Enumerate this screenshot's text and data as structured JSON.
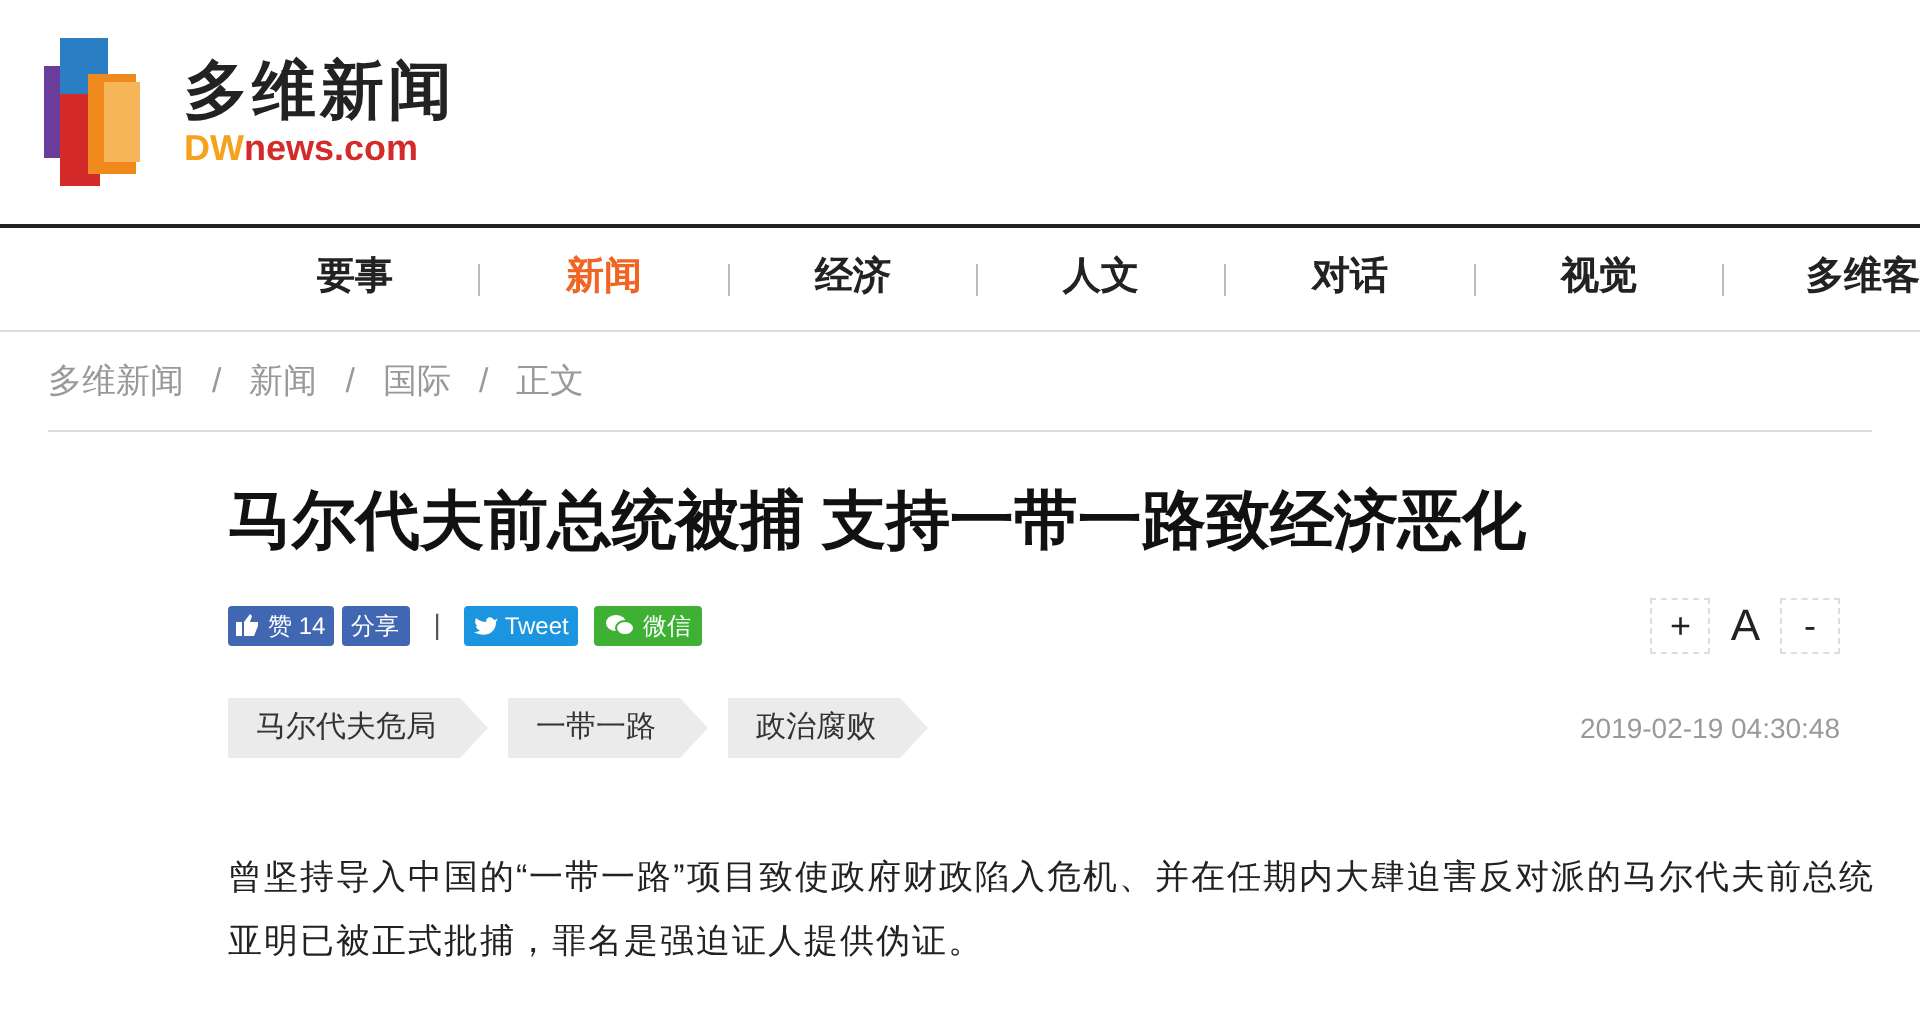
{
  "logo": {
    "name": "多维新闻",
    "domain_prefix": "DW",
    "domain_rest": "news.com"
  },
  "nav": [
    {
      "label": "要事",
      "selected": false
    },
    {
      "label": "新闻",
      "selected": true
    },
    {
      "label": "经济",
      "selected": false
    },
    {
      "label": "人文",
      "selected": false
    },
    {
      "label": "对话",
      "selected": false
    },
    {
      "label": "视觉",
      "selected": false
    },
    {
      "label": "多维客",
      "selected": false
    }
  ],
  "breadcrumb": [
    "多维新闻",
    "新闻",
    "国际",
    "正文"
  ],
  "breadcrumb_separator": "/",
  "article": {
    "title": "马尔代夫前总统被捕 支持一带一路致经济恶化",
    "share": [
      {
        "kind": "like",
        "label": "赞 14"
      },
      {
        "kind": "share",
        "label": "分享"
      },
      {
        "kind": "divider",
        "label": "|"
      },
      {
        "kind": "tweet",
        "label": "Tweet"
      },
      {
        "kind": "wechat",
        "label": "微信"
      }
    ],
    "font_controls": [
      "+",
      "A",
      "-"
    ],
    "tags": [
      "马尔代夫危局",
      "一带一路",
      "政治腐败"
    ],
    "date": "2019-02-19 04:30:48",
    "body": "曾坚持导入中国的“一带一路”项目致使政府财政陷入危机、并在任期内大肆迫害反对派的马尔代夫前总统亚明已被正式批捕，罪名是强迫证人提供伪证。"
  }
}
